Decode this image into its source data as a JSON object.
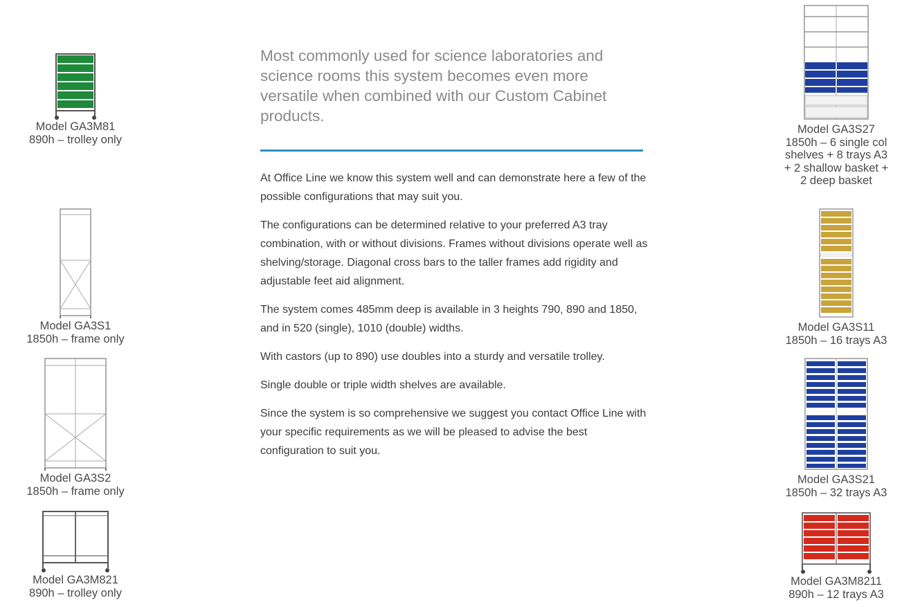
{
  "left_products": [
    {
      "model": "Model GA3M81",
      "spec": "890h – trolley only",
      "icon": "green-tray-trolley-icon"
    },
    {
      "model": "Model GA3S1",
      "spec": "1850h – frame only",
      "icon": "single-frame-icon"
    },
    {
      "model": "Model GA3S2",
      "spec": "1850h – frame only",
      "icon": "double-frame-icon"
    },
    {
      "model": "Model GA3M821",
      "spec": "890h – trolley only",
      "icon": "double-trolley-icon"
    }
  ],
  "right_products": [
    {
      "model": "Model GA3S27",
      "spec_lines": [
        "1850h – 6 single col",
        "shelves + 8 trays A3",
        "+ 2 shallow basket +",
        "2 deep basket"
      ],
      "icon": "shelf-basket-unit-icon"
    },
    {
      "model": "Model GA3S11",
      "spec_lines": [
        "1850h – 16 trays A3"
      ],
      "icon": "yellow-tray-unit-icon"
    },
    {
      "model": "Model GA3S21",
      "spec_lines": [
        "1850h – 32 trays A3"
      ],
      "icon": "blue-tray-unit-icon"
    },
    {
      "model": "Model GA3M8211",
      "spec_lines": [
        "890h – 12 trays A3"
      ],
      "icon": "red-tray-trolley-icon"
    }
  ],
  "intro": "Most commonly used for science laboratories and science rooms this system becomes even more versatile when combined with our Custom Cabinet products.",
  "paragraphs": [
    "At Office Line we know this system well and can demonstrate here a few of the possible configurations that may suit you.",
    "The configurations can be determined relative to your preferred A3 tray combination, with or without divisions. Frames without divisions operate well as shelving/storage. Diagonal cross bars to the taller frames add rigidity and adjustable feet aid alignment.",
    "The system comes 485mm deep is available in 3 heights 790, 890 and 1850, and in 520 (single), 1010 (double) widths.",
    "With castors (up to 890) use doubles into a sturdy and versatile trolley.",
    "Single double or triple width shelves are available.",
    "Since the system is so comprehensive we suggest you contact Office Line with your specific requirements as we will be pleased to advise the best configuration to suit you."
  ],
  "colors": {
    "accent_rule": "#2f8fc6",
    "green_tray": "#1e8a3a",
    "blue_tray": "#1f3fa0",
    "yellow_tray": "#c9a43a",
    "red_tray": "#d42a1e",
    "frame": "#9a9a9a"
  }
}
